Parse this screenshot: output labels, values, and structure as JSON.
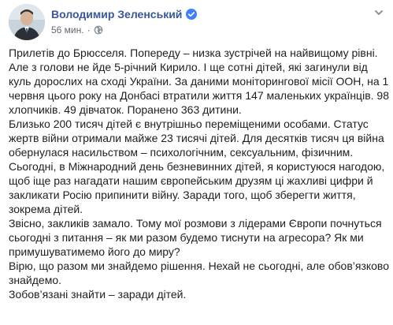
{
  "post": {
    "author": "Володимир Зеленський",
    "timestamp": "56 мин.",
    "separator": "·",
    "verified_icon": "verified-badge-icon",
    "privacy_icon": "globe-icon",
    "options_icon": "chevron-down-icon",
    "accent_color": "#385898",
    "paragraphs": [
      "Прилетів до Брюсселя. Попереду – низка зустрічей на найвищому рівні. Але з голови не йде 5-річний Кирило. І ще сотні дітей, які загинули від куль дорослих на сході України. За даними моніторингової місії ООН, на 1 червня цього року на Донбасі втратили життя 147 маленьких українців. 98 хлопчиків. 49 дівчаток. Поранено 363 дитини.",
      "Близько 200 тисяч дітей є внутрішньо переміщеними особами. Статус жертв війни отримали майже 23 тисячі дітей. Для десятків тисяч ця війна обернулася насильством – психологічним, сексуальним, фізичним.",
      "Сьогодні, в Міжнародний день безневинних дітей, я користуюся нагодою, щоб іще раз нагадати нашим європейським друзям ці жахливі цифри й закликати Росію припинити війну. Заради того, щоб зберегти життя, зокрема дітей.",
      "Звісно, закликів замало. Тому мої розмови з лідерами Європи почнуться сьогодні з питання – як ми разом будемо тиснути на агресора? Як ми примушуватимемо його до миру?",
      "Вірю, що разом ми знайдемо рішення. Нехай не сьогодні, але обов’язково знайдемо.",
      "Зобов’язані знайти – заради дітей."
    ]
  }
}
